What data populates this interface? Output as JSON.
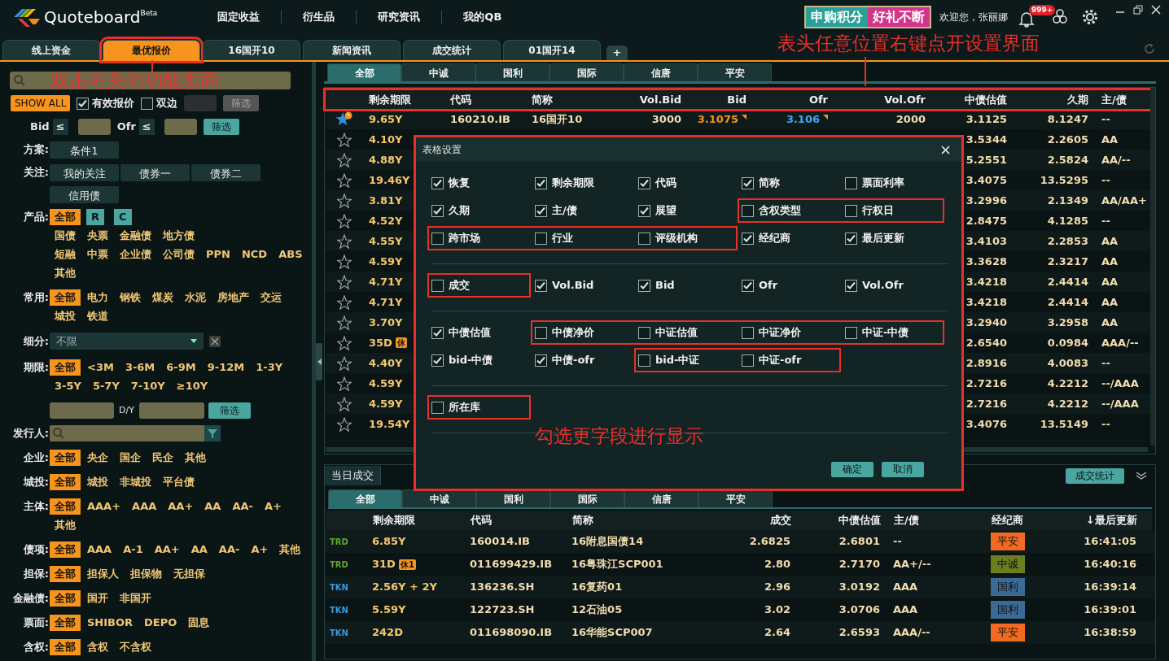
{
  "window": {
    "logo_text": "Quoteboard",
    "logo_tag": "Beta",
    "menu": [
      "固定收益",
      "衍生品",
      "研究资讯",
      "我的QB"
    ],
    "banner": [
      "申购积分",
      "好礼不断"
    ],
    "welcome": "欢迎您，张丽娜",
    "notification_count": "999+"
  },
  "tabs": [
    {
      "label": "线上资金",
      "selected": false,
      "framed": false
    },
    {
      "label": "最优报价",
      "selected": true,
      "framed": true
    },
    {
      "label": "16国开10",
      "selected": false,
      "framed": false
    },
    {
      "label": "新闻资讯",
      "selected": false,
      "framed": false
    },
    {
      "label": "成交统计",
      "selected": false,
      "framed": false
    },
    {
      "label": "01国开14",
      "selected": false,
      "framed": false
    }
  ],
  "add_tab": "+",
  "annotations": [
    "双击可关闭功能页面",
    "表头任意位置右键点开设置界面",
    "勾选更字段进行显示"
  ],
  "left_panel": {
    "sections": [
      {
        "kind": "search"
      },
      {
        "kind": "toolbar",
        "button": "SHOW ALL",
        "checks": [
          {
            "label": "有效报价",
            "checked": true
          },
          {
            "label": "双边",
            "checked": false
          }
        ],
        "filter": {
          "label": "筛选",
          "disabled": true
        }
      },
      {
        "kind": "bidofr",
        "fields": [
          {
            "label": "Bid",
            "op": "≤"
          },
          {
            "label": "Ofr",
            "op": "≤"
          }
        ],
        "filter": {
          "label": "筛选",
          "disabled": false
        }
      },
      {
        "kind": "buttons",
        "label": "方案:",
        "lines": [
          [
            "条件1"
          ]
        ]
      },
      {
        "kind": "buttons",
        "label": "关注:",
        "lines": [
          [
            "我的关注",
            "债券一",
            "债券二"
          ],
          [
            "信用债"
          ]
        ]
      },
      {
        "kind": "chips",
        "label": "产品:",
        "lines": [
          [
            {
              "text": "全部",
              "selected": true,
              "kind": "text"
            },
            {
              "text": "R",
              "selected": false,
              "kind": "tag"
            },
            {
              "text": "C",
              "selected": false,
              "kind": "tag"
            }
          ],
          [
            {
              "text": "国债",
              "selected": false,
              "kind": "text"
            },
            {
              "text": "央票",
              "selected": false,
              "kind": "text"
            },
            {
              "text": "金融债",
              "selected": false,
              "kind": "text"
            },
            {
              "text": "地方债",
              "selected": false,
              "kind": "text"
            }
          ],
          [
            {
              "text": "短融",
              "selected": false,
              "kind": "text"
            },
            {
              "text": "中票",
              "selected": false,
              "kind": "text"
            },
            {
              "text": "企业债",
              "selected": false,
              "kind": "text"
            },
            {
              "text": "公司债",
              "selected": false,
              "kind": "text"
            },
            {
              "text": "PPN",
              "selected": false,
              "kind": "text"
            },
            {
              "text": "NCD",
              "selected": false,
              "kind": "text"
            },
            {
              "text": "ABS",
              "selected": false,
              "kind": "text"
            }
          ],
          [
            {
              "text": "其他",
              "selected": false,
              "kind": "text"
            }
          ]
        ]
      },
      {
        "kind": "chips",
        "label": "常用:",
        "lines": [
          [
            {
              "text": "全部",
              "selected": true
            },
            {
              "text": "电力",
              "selected": false
            },
            {
              "text": "钢铁",
              "selected": false
            },
            {
              "text": "煤炭",
              "selected": false
            },
            {
              "text": "水泥",
              "selected": false
            },
            {
              "text": "房地产",
              "selected": false
            },
            {
              "text": "交运",
              "selected": false
            }
          ],
          [
            {
              "text": "城投",
              "selected": false
            },
            {
              "text": "铁道",
              "selected": false
            }
          ]
        ]
      },
      {
        "kind": "select",
        "label": "细分:",
        "value": "不限"
      },
      {
        "kind": "chips",
        "label": "期限:",
        "lines": [
          [
            {
              "text": "全部",
              "selected": true
            },
            {
              "text": "<3M",
              "selected": false
            },
            {
              "text": "3-6M",
              "selected": false
            },
            {
              "text": "6-9M",
              "selected": false
            },
            {
              "text": "9-12M",
              "selected": false
            },
            {
              "text": "1-3Y",
              "selected": false
            }
          ],
          [
            {
              "text": "3-5Y",
              "selected": false
            },
            {
              "text": "5-7Y",
              "selected": false
            },
            {
              "text": "7-10Y",
              "selected": false
            },
            {
              "text": "≥10Y",
              "selected": false
            }
          ]
        ]
      },
      {
        "kind": "range",
        "unit": "D/Y",
        "filter": {
          "label": "筛选",
          "disabled": false
        }
      },
      {
        "kind": "issuer",
        "label": "发行人:"
      },
      {
        "kind": "chips",
        "label": "企业:",
        "lines": [
          [
            {
              "text": "全部",
              "selected": true
            },
            {
              "text": "央企",
              "selected": false
            },
            {
              "text": "国企",
              "selected": false
            },
            {
              "text": "民企",
              "selected": false
            },
            {
              "text": "其他",
              "selected": false
            }
          ]
        ]
      },
      {
        "kind": "chips",
        "label": "城投:",
        "lines": [
          [
            {
              "text": "全部",
              "selected": true
            },
            {
              "text": "城投",
              "selected": false
            },
            {
              "text": "非城投",
              "selected": false
            },
            {
              "text": "平台债",
              "selected": false
            }
          ]
        ]
      },
      {
        "kind": "chips",
        "label": "主体:",
        "lines": [
          [
            {
              "text": "全部",
              "selected": true
            },
            {
              "text": "AAA+",
              "selected": false
            },
            {
              "text": "AAA",
              "selected": false
            },
            {
              "text": "AA+",
              "selected": false
            },
            {
              "text": "AA",
              "selected": false
            },
            {
              "text": "AA-",
              "selected": false
            },
            {
              "text": "A+",
              "selected": false
            }
          ],
          [
            {
              "text": "其他",
              "selected": false
            }
          ]
        ]
      },
      {
        "kind": "chips",
        "label": "债项:",
        "lines": [
          [
            {
              "text": "全部",
              "selected": true
            },
            {
              "text": "AAA",
              "selected": false
            },
            {
              "text": "A-1",
              "selected": false
            },
            {
              "text": "AA+",
              "selected": false
            },
            {
              "text": "AA",
              "selected": false
            },
            {
              "text": "AA-",
              "selected": false
            },
            {
              "text": "A+",
              "selected": false
            },
            {
              "text": "其他",
              "selected": false
            }
          ]
        ]
      },
      {
        "kind": "chips",
        "label": "担保:",
        "lines": [
          [
            {
              "text": "全部",
              "selected": true
            },
            {
              "text": "担保人",
              "selected": false
            },
            {
              "text": "担保物",
              "selected": false
            },
            {
              "text": "无担保",
              "selected": false
            }
          ]
        ]
      },
      {
        "kind": "chips",
        "label": "金融债:",
        "lines": [
          [
            {
              "text": "全部",
              "selected": true
            },
            {
              "text": "国开",
              "selected": false
            },
            {
              "text": "非国开",
              "selected": false
            }
          ]
        ]
      },
      {
        "kind": "chips",
        "label": "票面:",
        "lines": [
          [
            {
              "text": "全部",
              "selected": true
            },
            {
              "text": "SHIBOR",
              "selected": false
            },
            {
              "text": "DEPO",
              "selected": false
            },
            {
              "text": "固息",
              "selected": false
            }
          ]
        ]
      },
      {
        "kind": "chips",
        "label": "含权:",
        "lines": [
          [
            {
              "text": "全部",
              "selected": true
            },
            {
              "text": "含权",
              "selected": false
            },
            {
              "text": "不含权",
              "selected": false
            }
          ]
        ]
      }
    ]
  },
  "quotes": {
    "brokers": [
      {
        "label": "全部",
        "selected": true
      },
      {
        "label": "中诚",
        "selected": false
      },
      {
        "label": "国利",
        "selected": false
      },
      {
        "label": "国际",
        "selected": false
      },
      {
        "label": "信唐",
        "selected": false
      },
      {
        "label": "平安",
        "selected": false
      }
    ],
    "header_framed": true,
    "columns": [
      "剩余期限",
      "代码",
      "简称",
      "Vol.Bid",
      "Bid",
      "Ofr",
      "Vol.Ofr",
      "中债估值",
      "久期",
      "主/债"
    ],
    "rows": [
      {
        "starred": true,
        "remaining": "9.65Y",
        "code": "160210.IB",
        "name": "16国开10",
        "vol_bid": "3000",
        "bid": "3.1075",
        "bid_flag": true,
        "ofr": "3.106",
        "ofr_flag": true,
        "vol_ofr": "2000",
        "valuation": "3.1125",
        "duration": "8.1247",
        "rating": "--"
      },
      {
        "starred": false,
        "remaining": "4.10Y",
        "valuation": "3.5344",
        "duration": "2.2605",
        "rating": "AA"
      },
      {
        "starred": false,
        "remaining": "4.88Y",
        "valuation": "5.2551",
        "duration": "2.5824",
        "rating": "AA/--"
      },
      {
        "starred": false,
        "remaining": "19.46Y",
        "valuation": "3.4075",
        "duration": "13.5295",
        "rating": "--"
      },
      {
        "starred": false,
        "remaining": "3.81Y",
        "valuation": "3.2996",
        "duration": "2.1349",
        "rating": "AA/AA+"
      },
      {
        "starred": false,
        "remaining": "4.52Y",
        "valuation": "2.8475",
        "duration": "4.1285",
        "rating": "--"
      },
      {
        "starred": false,
        "remaining": "4.55Y",
        "valuation": "3.4103",
        "duration": "2.2853",
        "rating": "AA"
      },
      {
        "starred": false,
        "remaining": "4.59Y",
        "valuation": "3.3628",
        "duration": "2.3217",
        "rating": "AA"
      },
      {
        "starred": false,
        "remaining": "4.71Y",
        "valuation": "3.4218",
        "duration": "2.4414",
        "rating": "AA"
      },
      {
        "starred": false,
        "remaining": "4.71Y",
        "valuation": "3.4218",
        "duration": "2.4414",
        "rating": "AA"
      },
      {
        "starred": false,
        "remaining": "3.70Y",
        "valuation": "3.2940",
        "duration": "3.2958",
        "rating": "AA"
      },
      {
        "starred": false,
        "remaining": "35D",
        "badge": "休",
        "valuation": "2.6540",
        "duration": "0.0984",
        "rating": "AAA/--"
      },
      {
        "starred": false,
        "remaining": "4.40Y",
        "valuation": "2.8916",
        "duration": "4.0083",
        "rating": "--"
      },
      {
        "starred": false,
        "remaining": "4.59Y",
        "valuation": "2.7216",
        "duration": "4.2212",
        "rating": "--/AAA"
      },
      {
        "starred": false,
        "remaining": "4.59Y",
        "valuation": "2.7216",
        "duration": "4.2212",
        "rating": "--/AAA"
      },
      {
        "starred": false,
        "remaining": "19.54Y",
        "valuation": "3.4076",
        "duration": "13.5149",
        "rating": "--"
      }
    ]
  },
  "settings_dialog": {
    "title": "表格设置",
    "framed": true,
    "sections": [
      [
        [
          {
            "items": [
              {
                "label": "恢复",
                "checked": true
              },
              {
                "label": "剩余期限",
                "checked": true
              },
              {
                "label": "代码",
                "checked": true
              },
              {
                "label": "简称",
                "checked": true
              },
              {
                "label": "票面利率",
                "checked": false
              }
            ]
          }
        ],
        [
          {
            "items": [
              {
                "label": "久期",
                "checked": true
              },
              {
                "label": "主/债",
                "checked": true
              },
              {
                "label": "展望",
                "checked": true
              }
            ]
          },
          {
            "framed": true,
            "items": [
              {
                "label": "含权类型",
                "checked": false
              },
              {
                "label": "行权日",
                "checked": false
              }
            ]
          }
        ],
        [
          {
            "framed": true,
            "items": [
              {
                "label": "跨市场",
                "checked": false
              },
              {
                "label": "行业",
                "checked": false
              },
              {
                "label": "评级机构",
                "checked": false
              }
            ]
          },
          {
            "items": [
              {
                "label": "经纪商",
                "checked": true
              },
              {
                "label": "最后更新",
                "checked": true
              }
            ]
          }
        ]
      ],
      [
        [
          {
            "framed": true,
            "items": [
              {
                "label": "成交",
                "checked": false
              }
            ]
          },
          {
            "items": [
              {
                "label": "Vol.Bid",
                "checked": true
              },
              {
                "label": "Bid",
                "checked": true
              },
              {
                "label": "Ofr",
                "checked": true
              },
              {
                "label": "Vol.Ofr",
                "checked": true
              }
            ]
          }
        ]
      ],
      [
        [
          {
            "items": [
              {
                "label": "中债估值",
                "checked": true
              }
            ]
          },
          {
            "framed": true,
            "items": [
              {
                "label": "中债净价",
                "checked": false
              },
              {
                "label": "中证估值",
                "checked": false
              },
              {
                "label": "中证净价",
                "checked": false
              },
              {
                "label": "中证-中债",
                "checked": false
              }
            ]
          }
        ],
        [
          {
            "items": [
              {
                "label": "bid-中债",
                "checked": true
              },
              {
                "label": "中债-ofr",
                "checked": true
              }
            ]
          },
          {
            "framed": true,
            "items": [
              {
                "label": "bid-中证",
                "checked": false
              },
              {
                "label": "中证-ofr",
                "checked": false
              }
            ]
          }
        ]
      ],
      [
        [
          {
            "framed": true,
            "items": [
              {
                "label": "所在库",
                "checked": false
              }
            ]
          }
        ]
      ]
    ],
    "buttons": [
      "确定",
      "取消"
    ]
  },
  "trades": {
    "title": "当日成交",
    "stats_button": "成交统计",
    "brokers": [
      {
        "label": "全部",
        "selected": true
      },
      {
        "label": "中诚",
        "selected": false
      },
      {
        "label": "国利",
        "selected": false
      },
      {
        "label": "国际",
        "selected": false
      },
      {
        "label": "信唐",
        "selected": false
      },
      {
        "label": "平安",
        "selected": false
      }
    ],
    "columns": [
      "剩余期限",
      "代码",
      "简称",
      "成交",
      "中债估值",
      "主/债",
      "经纪商",
      "↓最后更新"
    ],
    "rows": [
      {
        "type": {
          "text": "TRD",
          "color": "#5fa52d"
        },
        "remaining": "6.85Y",
        "code": "160014.IB",
        "name": "16附息国债14",
        "deal": "2.6825",
        "valuation": "2.6801",
        "rating": "--",
        "broker": {
          "text": "平安",
          "color": "#f26a21"
        },
        "time": "16:41:05"
      },
      {
        "type": {
          "text": "TRD",
          "color": "#5fa52d"
        },
        "remaining": "31D",
        "badge": "休1",
        "code": "011699429.IB",
        "name": "16粤珠江SCP001",
        "deal": "2.80",
        "valuation": "2.7170",
        "rating": "AA+/--",
        "broker": {
          "text": "中诚",
          "color": "#6b7f1e"
        },
        "time": "16:40:16"
      },
      {
        "type": {
          "text": "TKN",
          "color": "#3a9be0"
        },
        "remaining": "2.56Y + 2Y",
        "code": "136236.SH",
        "name": "16复药01",
        "deal": "2.96",
        "valuation": "3.0192",
        "rating": "AAA",
        "broker": {
          "text": "国利",
          "color": "#3c6a96"
        },
        "time": "16:39:14"
      },
      {
        "type": {
          "text": "TKN",
          "color": "#3a9be0"
        },
        "remaining": "5.59Y",
        "code": "122723.SH",
        "name": "12石油05",
        "deal": "3.02",
        "valuation": "3.0706",
        "rating": "AAA",
        "broker": {
          "text": "国利",
          "color": "#3c6a96"
        },
        "time": "16:39:01"
      },
      {
        "type": {
          "text": "TKN",
          "color": "#3a9be0"
        },
        "remaining": "242D",
        "code": "011698090.IB",
        "name": "16华能SCP007",
        "deal": "2.64",
        "valuation": "2.6593",
        "rating": "AAA/--",
        "broker": {
          "text": "平安",
          "color": "#f26a21"
        },
        "time": "16:38:59"
      }
    ]
  }
}
